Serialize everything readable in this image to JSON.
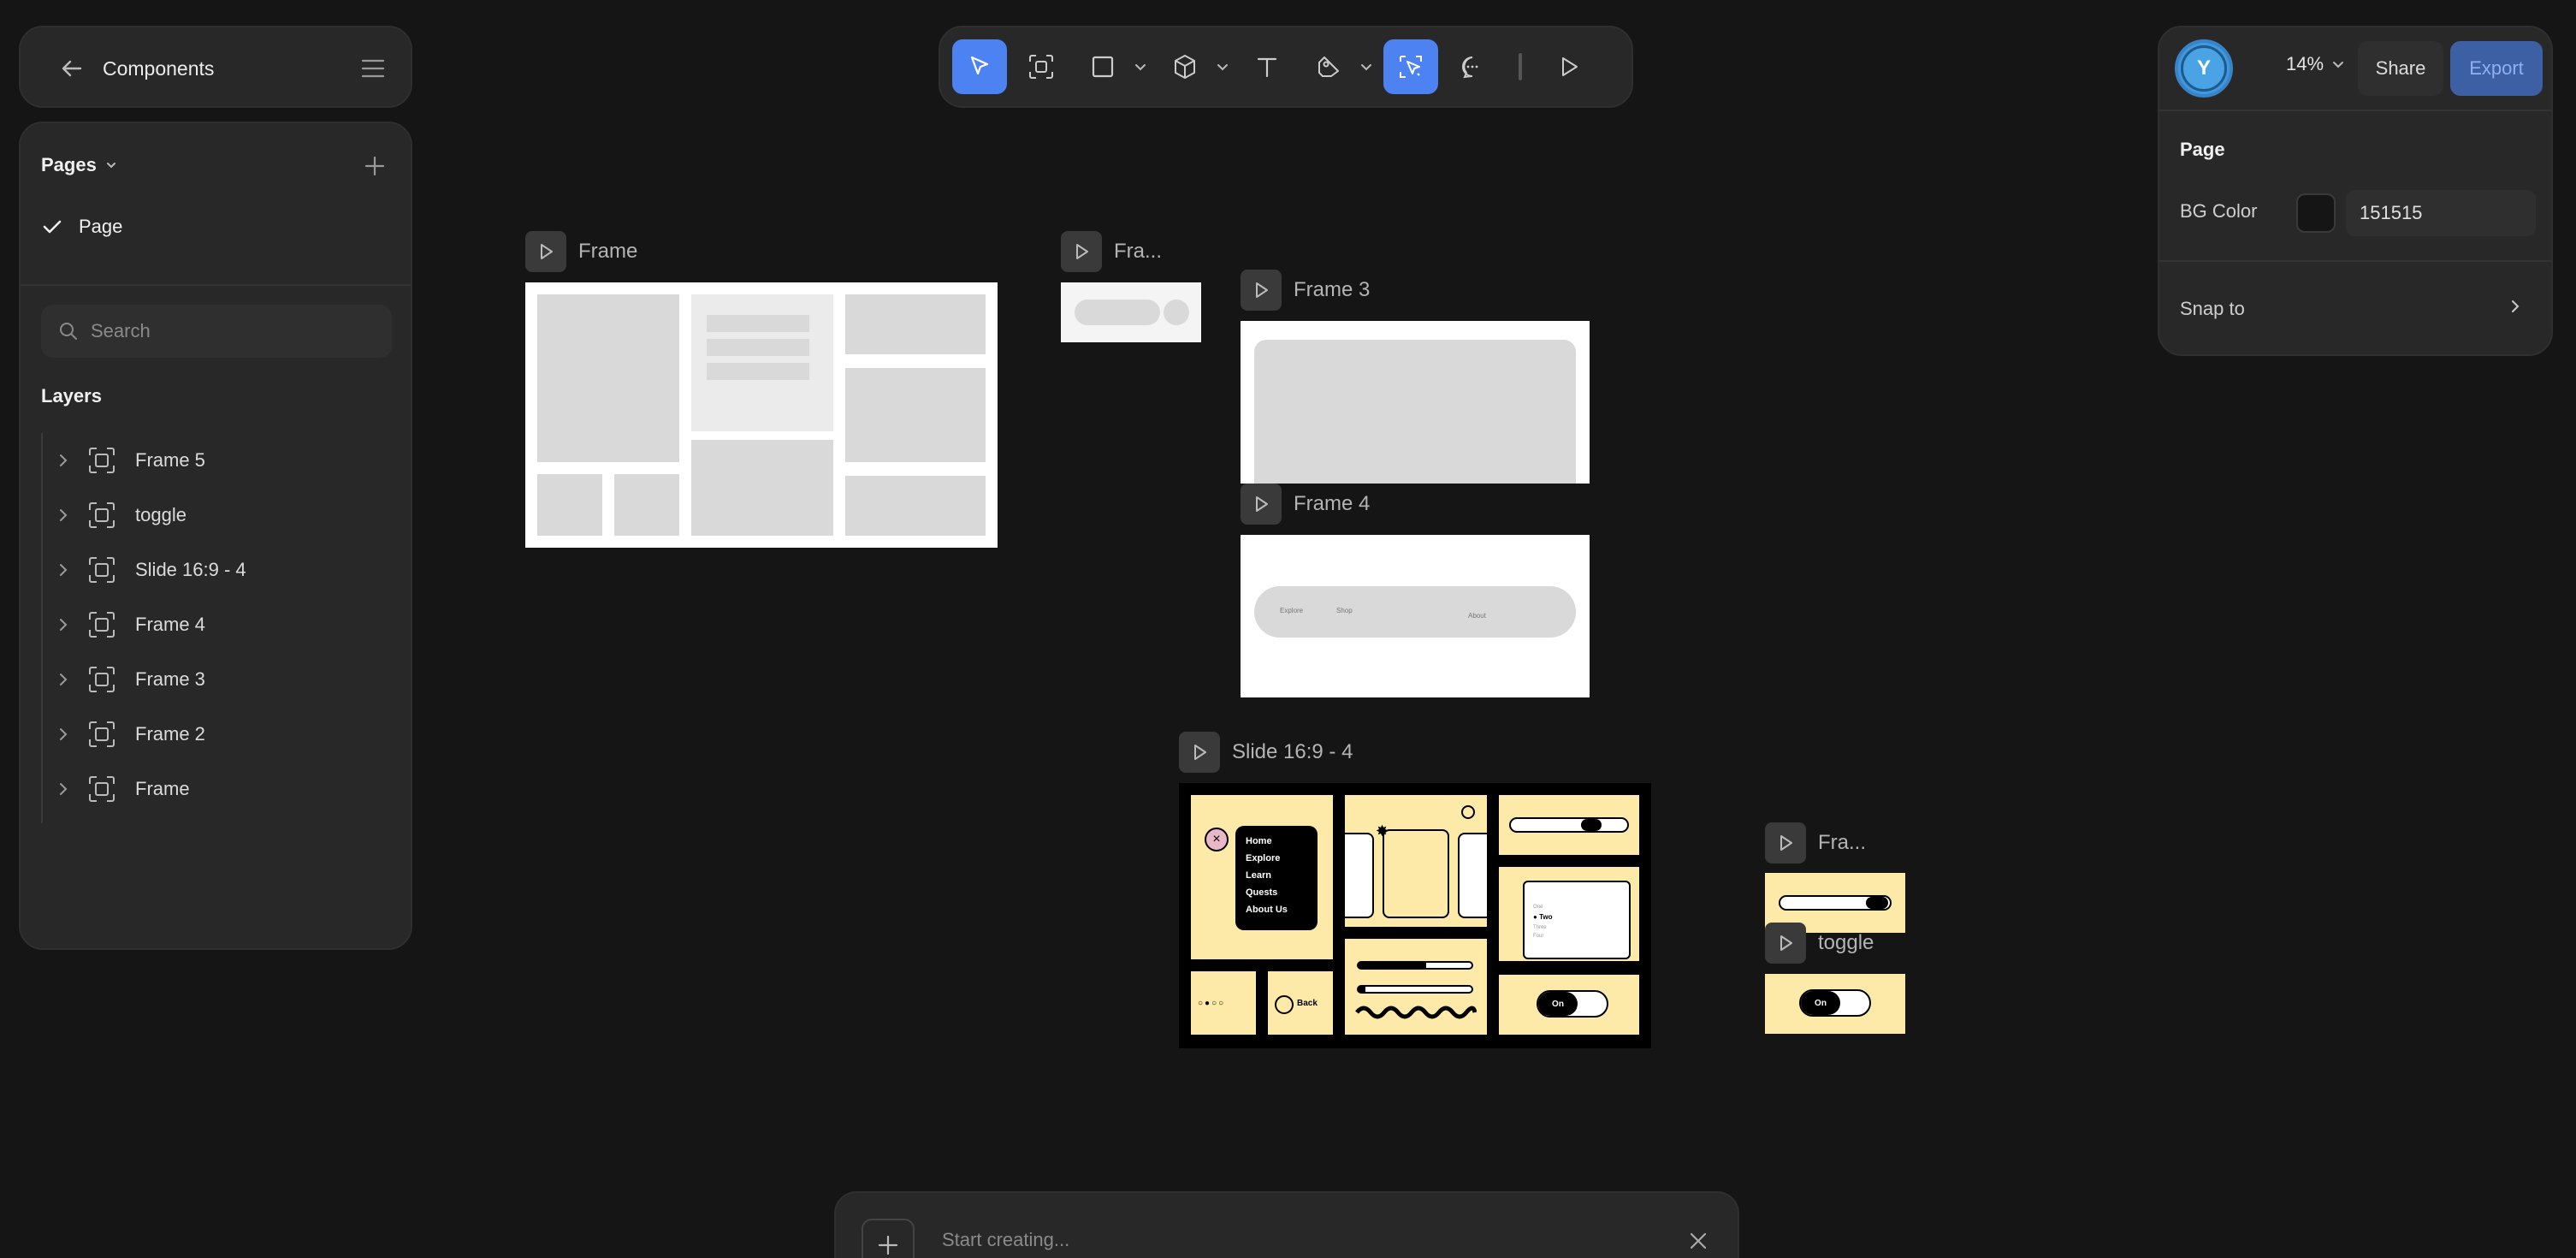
{
  "header": {
    "title": "Components"
  },
  "sidebar": {
    "pages_label": "Pages",
    "pages": [
      {
        "label": "Page",
        "selected": true
      }
    ],
    "search_placeholder": "Search",
    "layers_label": "Layers",
    "layers": [
      {
        "label": "Frame 5"
      },
      {
        "label": "toggle"
      },
      {
        "label": "Slide 16:9 - 4"
      },
      {
        "label": "Frame 4"
      },
      {
        "label": "Frame 3"
      },
      {
        "label": "Frame 2"
      },
      {
        "label": "Frame"
      }
    ]
  },
  "toolbar": {
    "tools": [
      "select-tool",
      "frame-tool",
      "rectangle-tool",
      "3d-tool",
      "text-tool",
      "pen-tool",
      "ai-tool",
      "comment-tool",
      "preview-tool"
    ],
    "active_tool": "ai-tool"
  },
  "right_panel": {
    "avatar_initial": "Y",
    "zoom": "14%",
    "share_label": "Share",
    "export_label": "Export",
    "page_label": "Page",
    "bg_color_label": "BG Color",
    "bg_color_value": "151515",
    "snap_label": "Snap to"
  },
  "canvas": {
    "frames": {
      "frame": "Frame",
      "frame2": "Fra...",
      "frame3": "Frame 3",
      "frame4": "Frame 4",
      "slide": "Slide 16:9 - 4",
      "frame5": "Fra...",
      "toggle": "toggle"
    },
    "frame4_nav": [
      "Explore",
      "Shop",
      "About"
    ],
    "slide_menu": [
      "Home",
      "Explore",
      "Learn",
      "Quests",
      "About Us"
    ],
    "slide_back": "Back",
    "slide_on": "On",
    "slide_radio": [
      "One",
      "Two",
      "Three",
      "Four"
    ],
    "toggle_on": "On"
  },
  "bottom_bar": {
    "placeholder": "Start creating..."
  },
  "colors": {
    "background": "#151515",
    "panel": "#282828",
    "accent": "#4d82f3",
    "frame_yellow": "#fde9a8"
  }
}
